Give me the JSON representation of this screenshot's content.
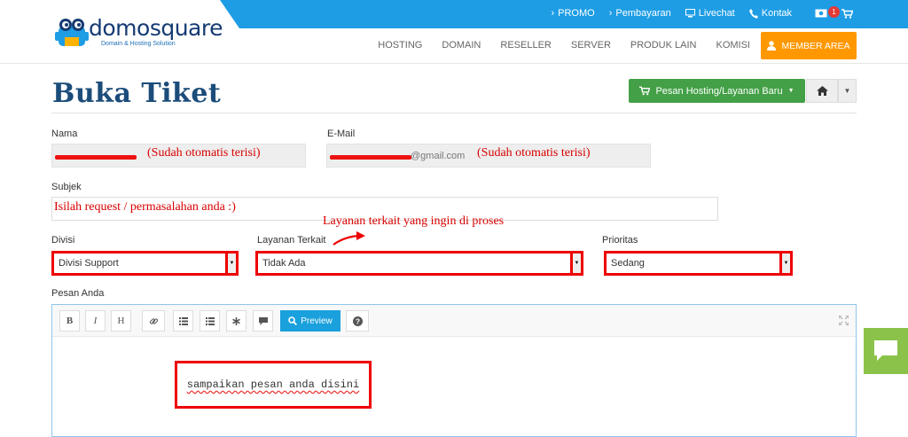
{
  "header": {
    "brand": "domosquare",
    "tagline": "Domain & Hosting Solution",
    "toplinks": [
      "PROMO",
      "Pembayaran",
      "Livechat",
      "Kontak"
    ],
    "cart_badge": "1",
    "nav": [
      "HOSTING",
      "DOMAIN",
      "RESELLER",
      "SERVER",
      "PRODUK LAIN",
      "KOMISI"
    ],
    "member_area": "MEMBER AREA"
  },
  "page": {
    "title": "Buka Tiket",
    "new_order_button": "Pesan Hosting/Layanan Baru"
  },
  "form": {
    "name_label": "Nama",
    "email_label": "E-Mail",
    "email_suffix": "@gmail.com",
    "subject_label": "Subjek",
    "division_label": "Divisi",
    "division_value": "Divisi Support",
    "service_label": "Layanan Terkait",
    "service_value": "Tidak Ada",
    "priority_label": "Prioritas",
    "priority_value": "Sedang",
    "message_label": "Pesan Anda"
  },
  "editor": {
    "buttons": [
      "B",
      "I",
      "H"
    ],
    "preview": "Preview",
    "placeholder": "sampaikan pesan anda disini"
  },
  "annotations": {
    "autofill_name": "(Sudah otomatis terisi)",
    "autofill_email": "(Sudah otomatis terisi)",
    "subject_hint": "Isilah request / permasalahan anda :)",
    "service_hint": "Layanan terkait yang ingin di proses"
  },
  "colors": {
    "accent_blue": "#1e9de5",
    "orange": "#ff9800",
    "green": "#43a047",
    "annotation_red": "#e00000"
  }
}
